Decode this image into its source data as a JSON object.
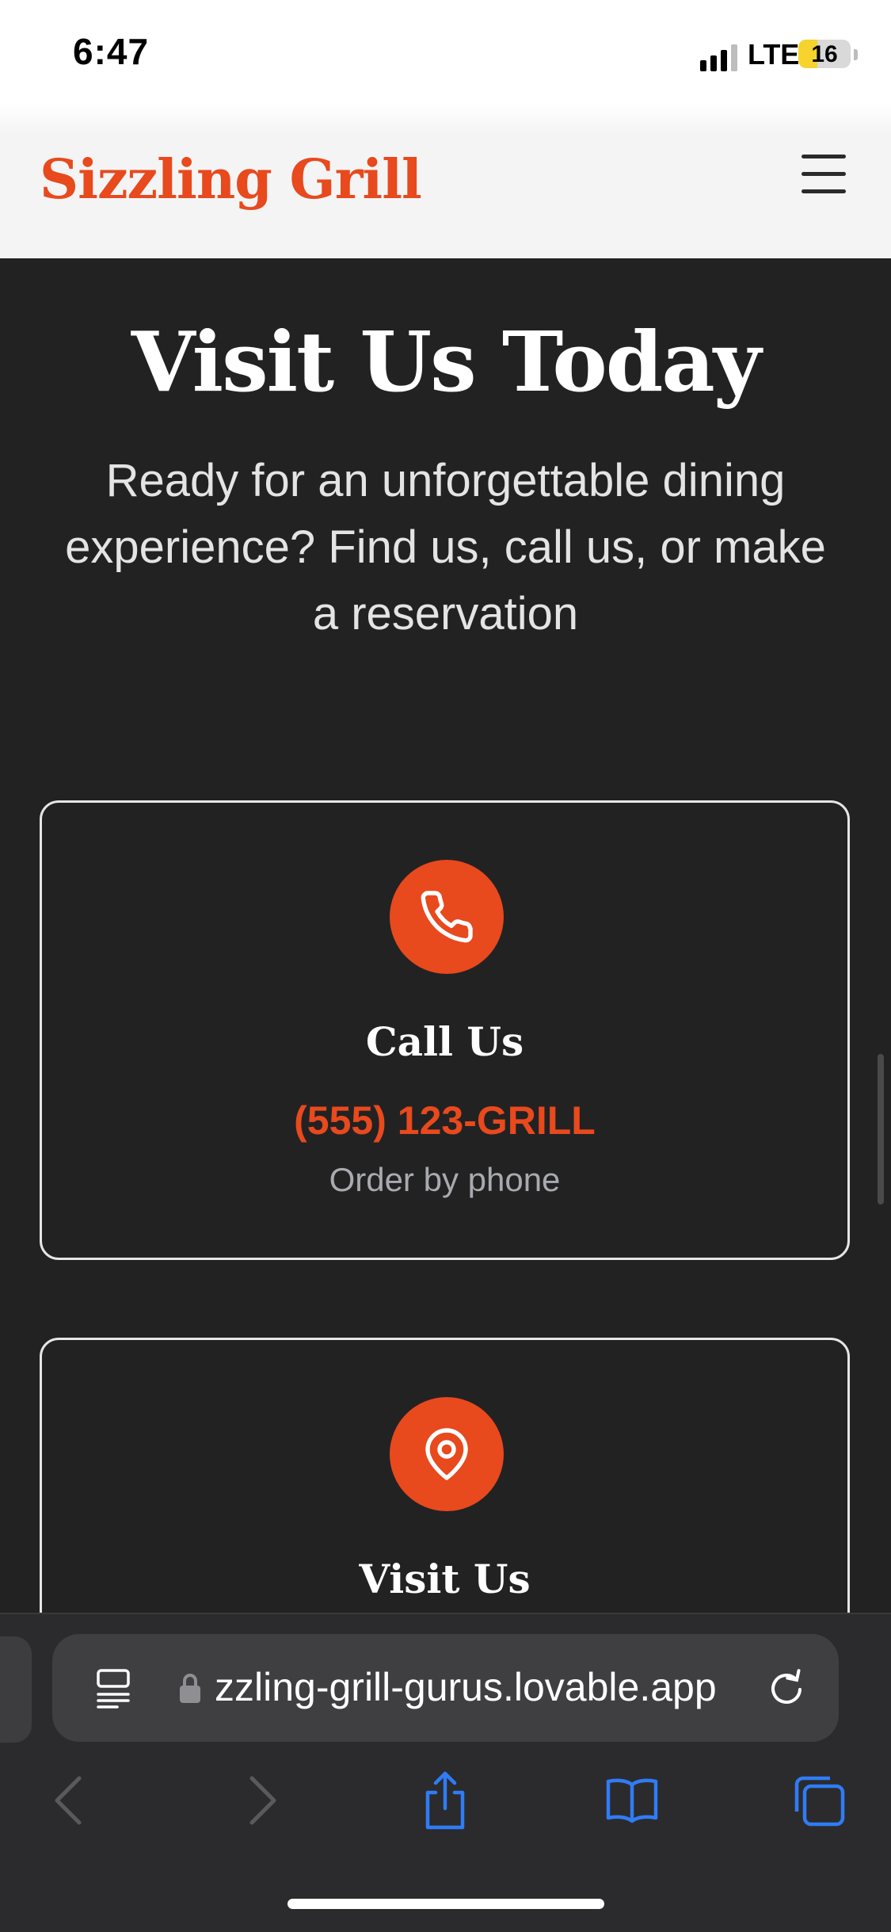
{
  "status": {
    "time": "6:47",
    "network": "LTE",
    "battery": "16"
  },
  "header": {
    "brand": "Sizzling Grill",
    "brand_color": "#e8491d"
  },
  "hero": {
    "title": "Visit Us Today",
    "subtitle": "Ready for an unforgettable dining experience? Find us, call us, or make a reservation"
  },
  "cards": [
    {
      "icon": "phone-icon",
      "title": "Call Us",
      "phone": "(555) 123-GRILL",
      "note": "Order by phone"
    },
    {
      "icon": "map-pin-icon",
      "title": "Visit Us"
    }
  ],
  "browser": {
    "url": "zzling-grill-gurus.lovable.app",
    "toolbar": [
      "back-icon",
      "forward-icon",
      "share-icon",
      "bookmarks-icon",
      "tabs-icon"
    ]
  },
  "colors": {
    "accent": "#e8491d",
    "background": "#222223",
    "safari_blue": "#2f7cf6"
  }
}
